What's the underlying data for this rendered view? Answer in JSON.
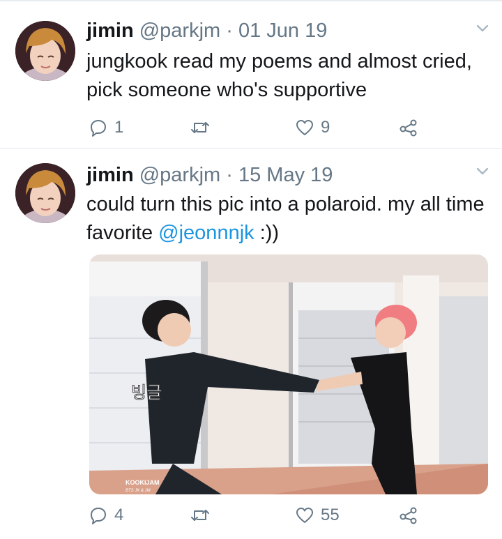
{
  "tweets": [
    {
      "author_name": "jimin",
      "handle": "@parkjm",
      "separator": "·",
      "date": "01 Jun 19",
      "text": "jungkook read my poems and almost cried, pick someone who's supportive",
      "reply_count": "1",
      "retweet_count": "",
      "like_count": "9"
    },
    {
      "author_name": "jimin",
      "handle": "@parkjm",
      "separator": "·",
      "date": "15 May 19",
      "text_before": "could turn this pic into a polaroid. my all time favorite ",
      "mention": "@jeonnnjk",
      "text_after": " :))",
      "reply_count": "4",
      "retweet_count": "",
      "like_count": "55",
      "media": {
        "caption_korean": "빙글",
        "watermark_title": "KOOKIJAM",
        "watermark_subtitle": "BTS JK & JM"
      }
    }
  ],
  "icons": {
    "reply": "reply-icon",
    "retweet": "retweet-icon",
    "like": "heart-icon",
    "share": "share-icon",
    "menu": "chevron-down-icon"
  },
  "colors": {
    "text": "#14171a",
    "muted": "#657786",
    "link": "#1b95e0",
    "divider": "#e1e8ed"
  }
}
